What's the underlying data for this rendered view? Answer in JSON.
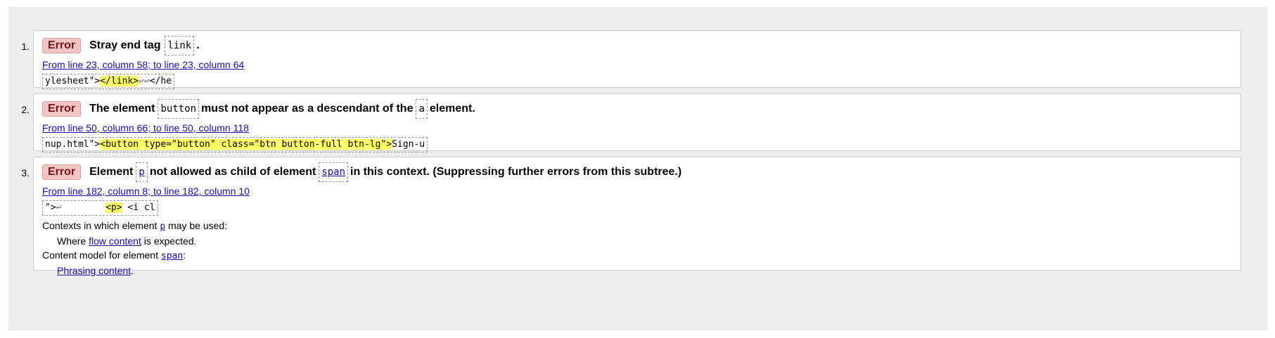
{
  "messages": [
    {
      "number": "1.",
      "type": "Error",
      "text_before": "Stray end tag",
      "code1": "link",
      "text_after": ".",
      "location": "From line 23, column 58; to line 23, column 64",
      "extract_pre": "ylesheet\">",
      "extract_hl": "</link>",
      "extract_mid": "↩↩",
      "extract_post": "</he"
    },
    {
      "number": "2.",
      "type": "Error",
      "text_before": "The element",
      "code1": "button",
      "text_mid": "must not appear as a descendant of the",
      "code2": "a",
      "text_after": "element.",
      "location": "From line 50, column 66; to line 50, column 118",
      "extract_pre": "nup.html\">",
      "extract_hl": "<button type=\"button\" class=\"btn button-full btn-lg\">",
      "extract_post": "Sign-u"
    },
    {
      "number": "3.",
      "type": "Error",
      "text_before": "Element",
      "code1": "p",
      "text_mid": "not allowed as child of element",
      "code2": "span",
      "text_after": "in this context. (Suppressing further errors from this subtree.)",
      "location": "From line 182, column 8; to line 182, column 10",
      "extract_pre": "\">",
      "extract_mid": "↩        ",
      "extract_hl": "<p>",
      "extract_post": " <i cl",
      "contexts_label_pre": "Contexts in which element",
      "contexts_label_code": "p",
      "contexts_label_post": "may be used:",
      "contexts_where": "Where",
      "contexts_link": "flow content",
      "contexts_expected": "is expected.",
      "content_model_pre": "Content model for element",
      "content_model_code": "span",
      "content_model_post": ":",
      "content_model_link": "Phrasing content",
      "content_model_end": "."
    }
  ]
}
